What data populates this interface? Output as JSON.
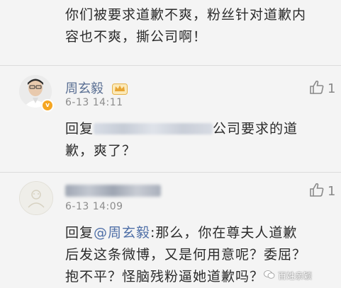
{
  "top_comment": {
    "lines": [
      "你们被要求道歉不爽，粉丝针对道歉内",
      "容也不爽，撕公司啊！"
    ]
  },
  "comments": [
    {
      "username": "周玄毅",
      "time": "6-13 14:11",
      "likes": "1",
      "reply_prefix": "回复",
      "reply_after": "公司要求的道",
      "body_line2": "歉，爽了？"
    },
    {
      "time": "6-13 14:09",
      "likes": "1",
      "reply_prefix": "回复",
      "mention": "@周玄毅",
      "reply_after": ":那么，你在尊夫人道歉",
      "body_line2": "后发这条微博，又是何用意呢？委屈？",
      "body_line3": "抱不平？怪脑残粉逼她道歉吗？"
    }
  ],
  "watermark": {
    "text": "百姓亲颖"
  },
  "colors": {
    "username": "#5a6f93",
    "mention": "#4f6fa7",
    "time": "#8c8c8c",
    "background": "#f4f4f4"
  }
}
